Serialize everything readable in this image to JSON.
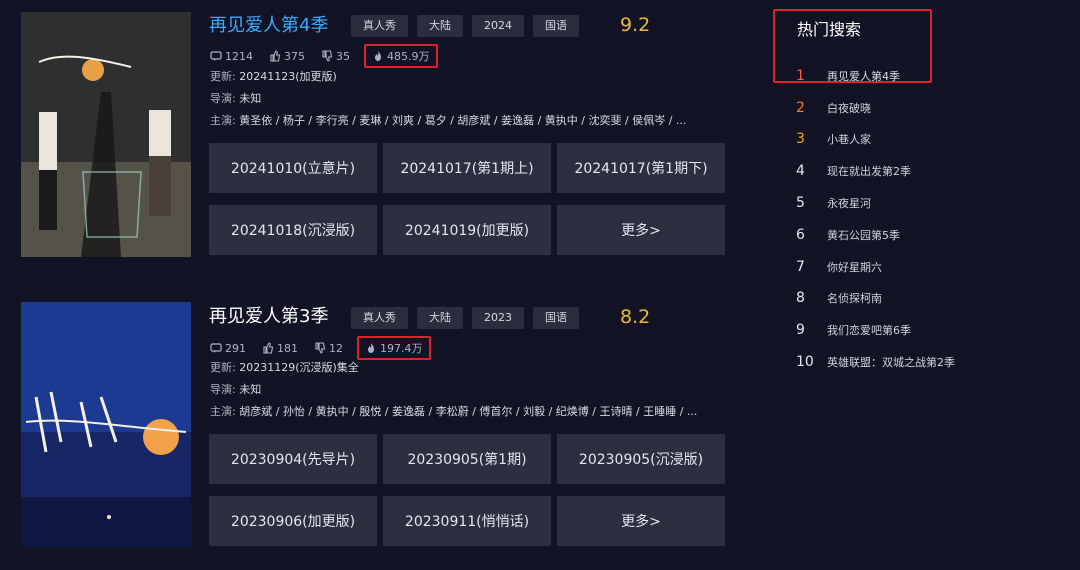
{
  "shows": [
    {
      "title": "再见爱人第4季",
      "tags": [
        "真人秀",
        "大陆",
        "2024",
        "国语"
      ],
      "score": "9.2",
      "stats": {
        "comments": "1214",
        "likes": "375",
        "dislikes": "35",
        "heat": "485.9万"
      },
      "update_label": "更新:",
      "update_value": "20241123(加更版)",
      "director_label": "导演:",
      "director_value": "未知",
      "cast_label": "主演:",
      "cast_value": "黄圣依 / 杨子 / 李行亮 / 麦琳 / 刘爽 / 葛夕 / 胡彦斌 / 姜逸磊 / 黄执中 / 沈奕斐 / 侯佩岑 / ...",
      "episodes": [
        "20241010(立意片)",
        "20241017(第1期上)",
        "20241017(第1期下)",
        "20241018(沉浸版)",
        "20241019(加更版)",
        "更多>"
      ]
    },
    {
      "title": "再见爱人第3季",
      "tags": [
        "真人秀",
        "大陆",
        "2023",
        "国语"
      ],
      "score": "8.2",
      "stats": {
        "comments": "291",
        "likes": "181",
        "dislikes": "12",
        "heat": "197.4万"
      },
      "update_label": "更新:",
      "update_value": "20231129(沉浸版)集全",
      "director_label": "导演:",
      "director_value": "未知",
      "cast_label": "主演:",
      "cast_value": "胡彦斌 / 孙怡 / 黄执中 / 殷悦 / 姜逸磊 / 李松蔚 / 傅首尔 / 刘毅 / 纪焕博 / 王诗晴 / 王睡睡 / ...",
      "episodes": [
        "20230904(先导片)",
        "20230905(第1期)",
        "20230905(沉浸版)",
        "20230906(加更版)",
        "20230911(悄悄话)",
        "更多>"
      ]
    }
  ],
  "hot_search": {
    "title": "热门搜索",
    "items": [
      {
        "rank": "1",
        "label": "再见爱人第4季"
      },
      {
        "rank": "2",
        "label": "白夜破晓"
      },
      {
        "rank": "3",
        "label": "小巷人家"
      },
      {
        "rank": "4",
        "label": "现在就出发第2季"
      },
      {
        "rank": "5",
        "label": "永夜星河"
      },
      {
        "rank": "6",
        "label": "黄石公园第5季"
      },
      {
        "rank": "7",
        "label": "你好星期六"
      },
      {
        "rank": "8",
        "label": "名侦探柯南"
      },
      {
        "rank": "9",
        "label": "我们恋爱吧第6季"
      },
      {
        "rank": "10",
        "label": "英雄联盟：双城之战第2季"
      }
    ]
  },
  "colors": {
    "background": "#121425",
    "accent_blue": "#39a9ff",
    "score": "#f0b63c",
    "highlight_box": "#e2202a",
    "button": "#2c2f40"
  },
  "icons": {
    "comments": "comment-icon",
    "likes": "thumb-up-icon",
    "dislikes": "thumb-down-icon",
    "heat": "flame-icon"
  }
}
